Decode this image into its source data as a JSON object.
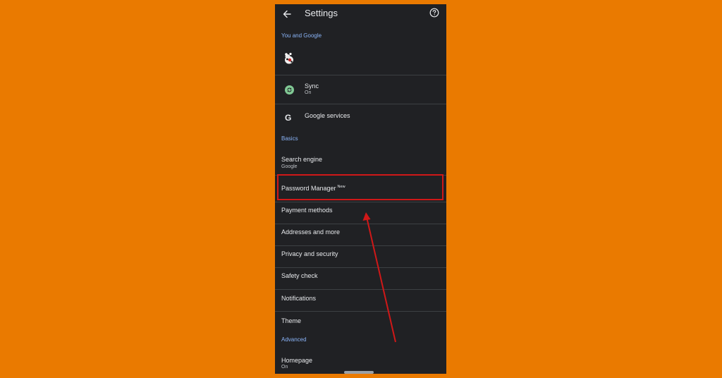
{
  "appbar": {
    "title": "Settings"
  },
  "sections": {
    "you_and_google": "You and Google",
    "basics": "Basics",
    "advanced": "Advanced"
  },
  "rows": {
    "sync": {
      "title": "Sync",
      "subtitle": "On"
    },
    "google_services": {
      "title": "Google services"
    },
    "search_engine": {
      "title": "Search engine",
      "subtitle": "Google"
    },
    "password_manager": {
      "title": "Password Manager",
      "badge": "New"
    },
    "payment_methods": {
      "title": "Payment methods"
    },
    "addresses": {
      "title": "Addresses and more"
    },
    "privacy": {
      "title": "Privacy and security"
    },
    "safety_check": {
      "title": "Safety check"
    },
    "notifications": {
      "title": "Notifications"
    },
    "theme": {
      "title": "Theme"
    },
    "homepage": {
      "title": "Homepage",
      "subtitle": "On"
    }
  },
  "icons": {
    "back": "arrow-back-icon",
    "help": "help-circle-icon",
    "sync": "sync-icon",
    "google": "google-g-icon"
  },
  "colors": {
    "background": "#ea7a00",
    "panel": "#202124",
    "accent": "#8ab4f8",
    "sync_green": "#81c995",
    "highlight_red": "#d01818"
  }
}
